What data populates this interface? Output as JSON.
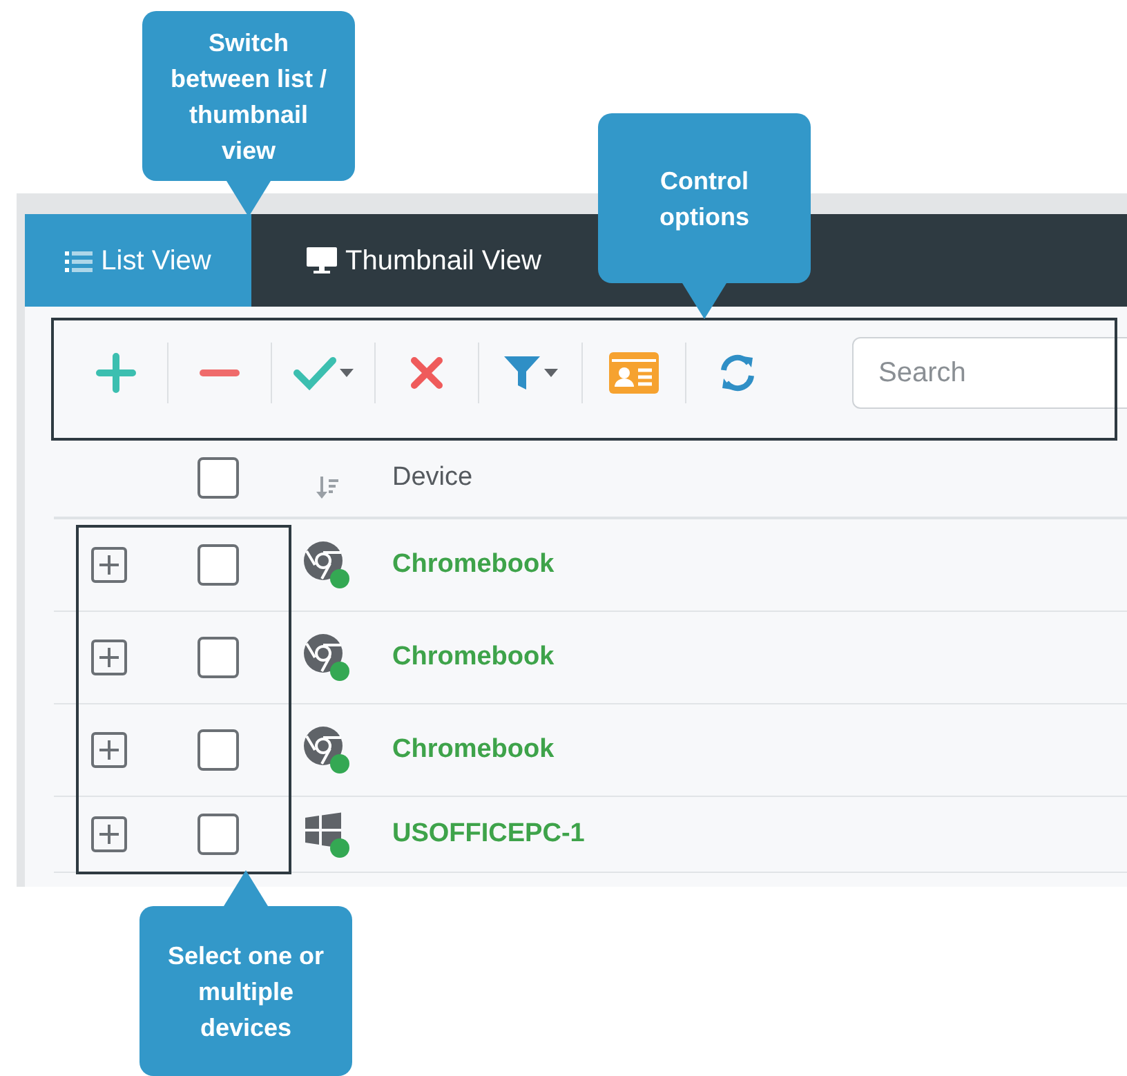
{
  "tabs": [
    {
      "label": "List View",
      "kind": "list",
      "selected": true
    },
    {
      "label": "Thumbnail View",
      "kind": "thumbnail",
      "selected": false
    }
  ],
  "toolbar": {
    "buttons": [
      {
        "kind": "add",
        "has_menu": false
      },
      {
        "kind": "remove",
        "has_menu": false
      },
      {
        "kind": "approve",
        "has_menu": true
      },
      {
        "kind": "delete",
        "has_menu": false
      },
      {
        "kind": "filter",
        "has_menu": true
      },
      {
        "kind": "card",
        "has_menu": false
      },
      {
        "kind": "refresh",
        "has_menu": false
      }
    ],
    "search": {
      "placeholder": "Search"
    }
  },
  "table": {
    "select_all": {
      "checked": false
    },
    "columns": [
      {
        "label": "Device"
      }
    ],
    "rows": [
      {
        "device": "Chromebook",
        "kind": "chrome",
        "online": true,
        "checked": false
      },
      {
        "device": "Chromebook",
        "kind": "chrome",
        "online": true,
        "checked": false
      },
      {
        "device": "Chromebook",
        "kind": "chrome",
        "online": true,
        "checked": false
      },
      {
        "device": "USOFFICEPC-1",
        "kind": "windows",
        "online": true,
        "checked": false
      }
    ]
  },
  "callouts": [
    {
      "text": "Switch between list / thumbnail view",
      "kind": "below"
    },
    {
      "text": "Control options",
      "kind": "below"
    },
    {
      "text": "Select one or multiple devices",
      "kind": "above"
    }
  ]
}
